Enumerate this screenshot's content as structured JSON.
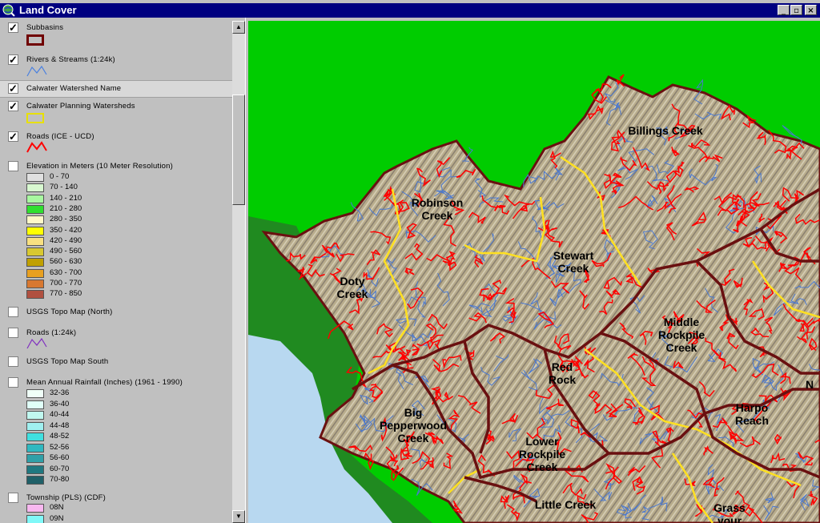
{
  "window": {
    "title": "Land Cover",
    "minimize": "_",
    "maximize": "▫",
    "close": "×"
  },
  "toc": {
    "layers": [
      {
        "name": "Subbasins",
        "checked": true
      },
      {
        "name": "Rivers & Streams (1:24k)",
        "checked": true
      },
      {
        "name": "Calwater Watershed Name",
        "checked": true
      },
      {
        "name": "Calwater Planning Watersheds",
        "checked": true
      },
      {
        "name": "Roads (ICE - UCD)",
        "checked": true
      },
      {
        "name": "Elevation in Meters (10 Meter Resolution)",
        "checked": false
      },
      {
        "name": "USGS Topo Map (North)",
        "checked": false
      },
      {
        "name": "Roads (1:24k)",
        "checked": false
      },
      {
        "name": "USGS Topo Map South",
        "checked": false
      },
      {
        "name": "Mean Annual Rainfall (Inches) (1961 - 1990)",
        "checked": false
      },
      {
        "name": "Township (PLS) (CDF)",
        "checked": false
      }
    ],
    "elevation_classes": [
      {
        "label": "0 - 70",
        "color": "#e0e0e0"
      },
      {
        "label": "70 - 140",
        "color": "#d8f8d0"
      },
      {
        "label": "140 - 210",
        "color": "#a8f8a0"
      },
      {
        "label": "210 - 280",
        "color": "#30e030"
      },
      {
        "label": "280 - 350",
        "color": "#fff8c8"
      },
      {
        "label": "350 - 420",
        "color": "#ffff00"
      },
      {
        "label": "420 - 490",
        "color": "#f8e080"
      },
      {
        "label": "490 - 560",
        "color": "#d8c830"
      },
      {
        "label": "560 - 630",
        "color": "#c0a000"
      },
      {
        "label": "630 - 700",
        "color": "#e8a020"
      },
      {
        "label": "700 - 770",
        "color": "#d87830"
      },
      {
        "label": "770 - 850",
        "color": "#b05040"
      }
    ],
    "rainfall_classes": [
      {
        "label": "32-36",
        "color": "#f0fff8"
      },
      {
        "label": "36-40",
        "color": "#e0fff8"
      },
      {
        "label": "40-44",
        "color": "#c0f8f0"
      },
      {
        "label": "44-48",
        "color": "#a0f0f0"
      },
      {
        "label": "48-52",
        "color": "#40e0e0"
      },
      {
        "label": "52-56",
        "color": "#30b8c0"
      },
      {
        "label": "56-60",
        "color": "#30a0a8"
      },
      {
        "label": "60-70",
        "color": "#207880"
      },
      {
        "label": "70-80",
        "color": "#206068"
      }
    ],
    "township_classes": [
      {
        "label": "08N",
        "color": "#f8b8f0"
      },
      {
        "label": "09N",
        "color": "#80f8f8"
      }
    ]
  },
  "map": {
    "colors": {
      "background_green": "#00cc00",
      "forest": "#208a20",
      "ocean": "#b8d8f0",
      "terrain": "#b0a888",
      "roads": "#ff0000",
      "streams": "#4a78d0",
      "subbasin": "#6a1010",
      "planning": "#ffe020"
    },
    "labels": [
      {
        "text": "Billings Creek"
      },
      {
        "text": "Robinson\nCreek"
      },
      {
        "text": "Stewart\nCreek"
      },
      {
        "text": "Doty\nCreek"
      },
      {
        "text": "Middle\nRockpile\nCreek"
      },
      {
        "text": "Red\nRock"
      },
      {
        "text": "Big\nPepperwood\nCreek"
      },
      {
        "text": "Harpo\nReach"
      },
      {
        "text": "Lower\nRockpile\nCreek"
      },
      {
        "text": "Little Creek"
      },
      {
        "text": "Grass\nyour"
      },
      {
        "text": "N"
      }
    ]
  }
}
